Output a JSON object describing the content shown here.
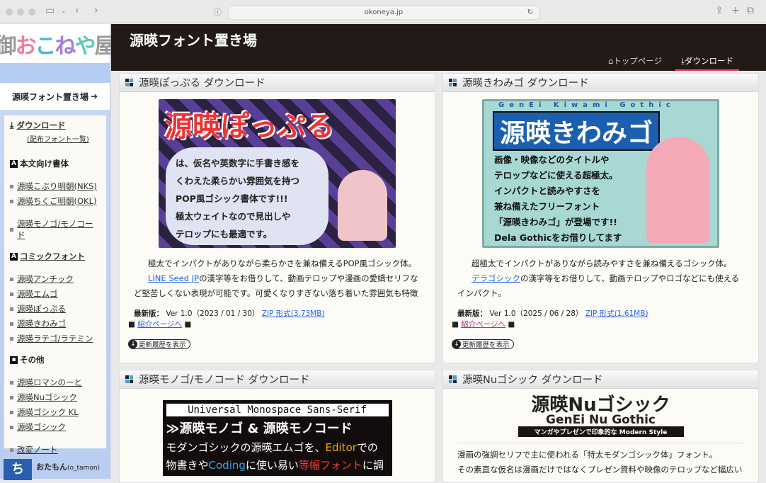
{
  "browser": {
    "url": "okoneya.jp"
  },
  "sidebar": {
    "logo": [
      "御",
      "お",
      "こ",
      "ね",
      "や",
      "屋"
    ],
    "site_link": "源暎フォント置き場",
    "download": "ダウンロード",
    "download_sub": "(配布フォント一覧)",
    "sections": [
      {
        "icon": "A",
        "title": "本文向け書体",
        "items": [
          "源暎こぶり明朝(NKS)",
          "源暎ちくご明朝(OKL)",
          "源暎モノゴ/モノコード"
        ]
      },
      {
        "icon": "A",
        "title": "コミックフォント",
        "items": [
          "源暎アンチック",
          "源暎エムゴ",
          "源暎ぽっぷる",
          "源暎きわみゴ",
          "源暎ラテゴ/ラテミン"
        ]
      },
      {
        "icon": "▪",
        "title": "その他",
        "items": [
          "源暎ロマンのーと",
          "源暎Nuゴシック",
          "源暎ゴシック KL",
          "源暎ゴシック",
          "改変ノート"
        ]
      }
    ],
    "profile": {
      "name": "おたもん",
      "handle": "(o_tamon)"
    }
  },
  "header": {
    "title": "源暎フォント置き場",
    "tabs": [
      "トップページ",
      "ダウンロード"
    ]
  },
  "cards": [
    {
      "title": "源暎ぽっぷる ダウンロード",
      "banner": {
        "title": "源暎ぽっぷる",
        "lines": [
          "は、仮名や英数字に手書き感を",
          "くわえた柔らかい雰囲気を持つ",
          "POP風ゴシック書体です!!!",
          "極太ウェイトなので見出しや",
          "テロップにも最適です。"
        ]
      },
      "desc1": "極太でインパクトがありながら柔らかさを兼ね備えるPOP風ゴシック体。",
      "link": "LINE Seed JP",
      "desc2": "の漢字等をお借りして、動画テロップや漫画の愛嬌セリフなど堅苦しくない表現が可能です。可愛くなりすぎない落ち着いた雰囲気も特徴",
      "version_label": "最新版：",
      "version": "Ver 1.0（2023 / 01 / 30）",
      "zip": "ZIP 形式(3.73MB)",
      "intro": "紹介ページへ",
      "history": "更新履歴を表示"
    },
    {
      "title": "源暎きわみゴ ダウンロード",
      "banner": {
        "subtitle": "GenEi Kiwami Gothic",
        "title": "源暎きわみゴ",
        "lines": [
          "画像・映像などのタイトルや",
          "テロップなどに使える超極太。",
          "インパクトと読みやすさを",
          "兼ね備えたフリーフォント",
          "「源暎きわみゴ」が登場です!!",
          "Dela Gothicをお借りしてます"
        ]
      },
      "desc1": "超極太でインパクトがありながら読みやすさを兼ね備えるゴシック体。",
      "link": "デラゴシック",
      "desc2": "の漢字等をお借りして、動画テロップやロゴなどにも使えるインパクト。",
      "version_label": "最新版：",
      "version": "Ver 1.0（2025 / 06 / 28）",
      "zip": "ZIP 形式(1.61MB)",
      "intro": "紹介ページへ",
      "history": "更新履歴を表示"
    },
    {
      "title": "源暎モノゴ/モノコード ダウンロード",
      "banner": {
        "top": "Universal Monospace Sans-Serif",
        "title": "≫源暎モノゴ & 源暎モノコード",
        "l1a": "モダンゴシックの源暎エムゴを、",
        "l1b": "Editor",
        "l1c": "での",
        "l2a": "物書きや",
        "l2b": "Coding",
        "l2c": "に使い易い",
        "l2d": "等幅フォント",
        "l2e": "に調"
      }
    },
    {
      "title": "源暎Nuゴシック ダウンロード",
      "banner": {
        "title": "源暎Nuゴシック",
        "subtitle": "GenEi Nu Gothic",
        "tagline": "マンガやプレゼンで印象的な Modern Style"
      },
      "desc1": "漫画の強調セリフで主に使われる「特太モダンゴシック体」フォント。",
      "desc2": "その素直な仮名は漫画だけではなくプレゼン資料や映像のテロップなど幅広い"
    }
  ]
}
